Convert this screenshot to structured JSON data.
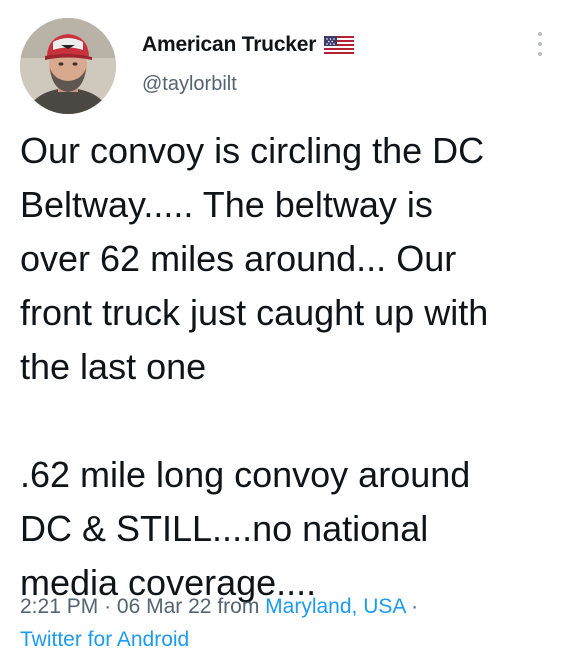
{
  "author": {
    "display_name": "American Trucker",
    "handle": "@taylorbilt",
    "flag_icon": "us-flag-icon",
    "avatar_icon": "profile-avatar"
  },
  "menu_icon": "more-vertical-icon",
  "tweet": {
    "lines": [
      "Our convoy is circling the DC",
      "Beltway..... The beltway is",
      "over 62 miles around... Our",
      "front truck just caught up with",
      "the last one",
      ".62 mile long convoy around",
      "DC & STILL....no national",
      "media coverage...."
    ]
  },
  "meta": {
    "time": "2:21 PM",
    "separator": "·",
    "date": "06 Mar 22",
    "from_text": "from",
    "location": "Maryland, USA",
    "source": "Twitter for Android"
  },
  "colors": {
    "text_primary": "#0f1419",
    "text_secondary": "#536471",
    "link": "#1d9bf0"
  }
}
